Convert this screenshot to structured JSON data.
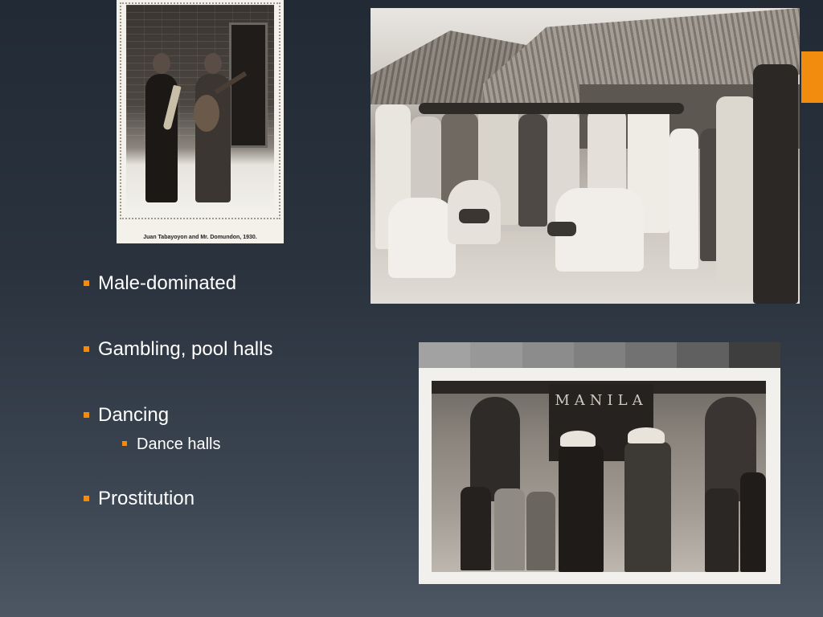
{
  "slide": {
    "accent_color": "#f28c0f",
    "bullets": [
      {
        "text": "Male-dominated"
      },
      {
        "text": "Gambling, pool halls"
      },
      {
        "text": "Dancing",
        "sub": [
          {
            "text": "Dance halls"
          }
        ]
      },
      {
        "text": "Prostitution"
      }
    ]
  },
  "photos": {
    "portrait_caption": "Juan Tabayoyon and Mr. Domundon, 1930.",
    "poolhall_sign": "MANILA"
  }
}
